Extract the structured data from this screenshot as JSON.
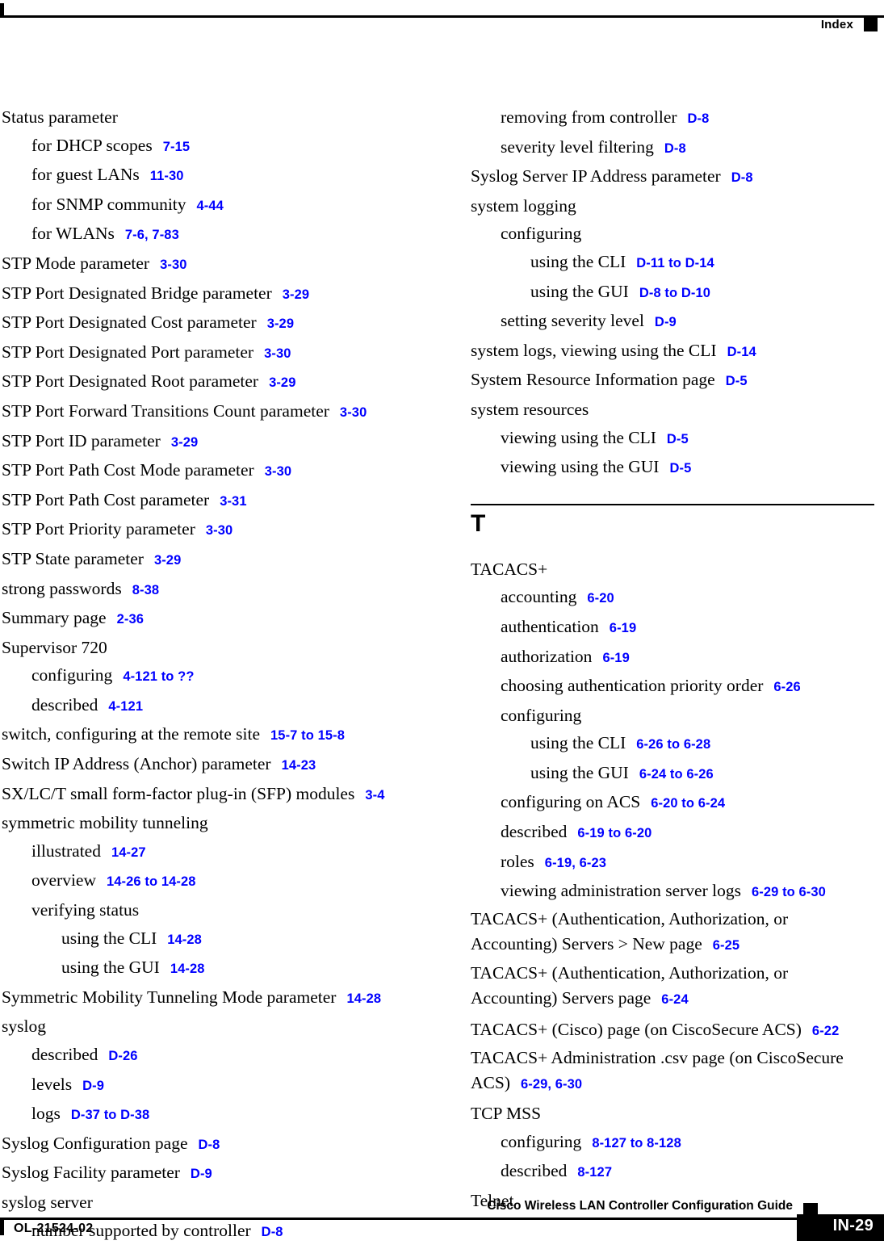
{
  "header": {
    "title": "Index"
  },
  "footer": {
    "guide_title": "Cisco Wireless LAN Controller Configuration Guide",
    "doc_id": "OL-21524-02",
    "page_number": "IN-29"
  },
  "colors": {
    "page_reference": "#0000ff",
    "text": "#000000",
    "background": "#ffffff"
  },
  "left_column": {
    "entries": [
      {
        "level": 0,
        "text": "Status parameter",
        "refs": ""
      },
      {
        "level": 1,
        "text": "for DHCP scopes",
        "refs": "7-15"
      },
      {
        "level": 1,
        "text": "for guest LANs",
        "refs": "11-30"
      },
      {
        "level": 1,
        "text": "for SNMP community",
        "refs": "4-44"
      },
      {
        "level": 1,
        "text": "for WLANs",
        "refs": "7-6, 7-83"
      },
      {
        "level": 0,
        "text": "STP Mode parameter",
        "refs": "3-30"
      },
      {
        "level": 0,
        "text": "STP Port Designated Bridge parameter",
        "refs": "3-29"
      },
      {
        "level": 0,
        "text": "STP Port Designated Cost parameter",
        "refs": "3-29"
      },
      {
        "level": 0,
        "text": "STP Port Designated Port parameter",
        "refs": "3-30"
      },
      {
        "level": 0,
        "text": "STP Port Designated Root parameter",
        "refs": "3-29"
      },
      {
        "level": 0,
        "text": "STP Port Forward Transitions Count parameter",
        "refs": "3-30"
      },
      {
        "level": 0,
        "text": "STP Port ID parameter",
        "refs": "3-29"
      },
      {
        "level": 0,
        "text": "STP Port Path Cost Mode parameter",
        "refs": "3-30"
      },
      {
        "level": 0,
        "text": "STP Port Path Cost parameter",
        "refs": "3-31"
      },
      {
        "level": 0,
        "text": "STP Port Priority parameter",
        "refs": "3-30"
      },
      {
        "level": 0,
        "text": "STP State parameter",
        "refs": "3-29"
      },
      {
        "level": 0,
        "text": "strong passwords",
        "refs": "8-38"
      },
      {
        "level": 0,
        "text": "Summary page",
        "refs": "2-36"
      },
      {
        "level": 0,
        "text": "Supervisor 720",
        "refs": ""
      },
      {
        "level": 1,
        "text": "configuring",
        "refs": "4-121 to ??"
      },
      {
        "level": 1,
        "text": "described",
        "refs": "4-121"
      },
      {
        "level": 0,
        "text": "switch, configuring at the remote site",
        "refs": "15-7 to 15-8"
      },
      {
        "level": 0,
        "text": "Switch IP Address (Anchor) parameter",
        "refs": "14-23"
      },
      {
        "level": 0,
        "text": "SX/LC/T small form-factor plug-in (SFP) modules",
        "refs": "3-4"
      },
      {
        "level": 0,
        "text": "symmetric mobility tunneling",
        "refs": ""
      },
      {
        "level": 1,
        "text": "illustrated",
        "refs": "14-27"
      },
      {
        "level": 1,
        "text": "overview",
        "refs": "14-26 to 14-28"
      },
      {
        "level": 1,
        "text": "verifying status",
        "refs": ""
      },
      {
        "level": 2,
        "text": "using the CLI",
        "refs": "14-28"
      },
      {
        "level": 2,
        "text": "using the GUI",
        "refs": "14-28"
      },
      {
        "level": 0,
        "text": "Symmetric Mobility Tunneling Mode parameter",
        "refs": "14-28"
      },
      {
        "level": 0,
        "text": "syslog",
        "refs": ""
      },
      {
        "level": 1,
        "text": "described",
        "refs": "D-26"
      },
      {
        "level": 1,
        "text": "levels",
        "refs": "D-9"
      },
      {
        "level": 1,
        "text": "logs",
        "refs": "D-37 to D-38"
      },
      {
        "level": 0,
        "text": "Syslog Configuration page",
        "refs": "D-8"
      },
      {
        "level": 0,
        "text": "Syslog Facility parameter",
        "refs": "D-9"
      },
      {
        "level": 0,
        "text": "syslog server",
        "refs": ""
      },
      {
        "level": 1,
        "text": "number supported by controller",
        "refs": "D-8"
      }
    ]
  },
  "right_column": {
    "entries_before_section": [
      {
        "level": 1,
        "text": "removing from controller",
        "refs": "D-8"
      },
      {
        "level": 1,
        "text": "severity level filtering",
        "refs": "D-8"
      },
      {
        "level": 0,
        "text": "Syslog Server IP Address parameter",
        "refs": "D-8"
      },
      {
        "level": 0,
        "text": "system logging",
        "refs": ""
      },
      {
        "level": 1,
        "text": "configuring",
        "refs": ""
      },
      {
        "level": 2,
        "text": "using the CLI",
        "refs": "D-11 to D-14"
      },
      {
        "level": 2,
        "text": "using the GUI",
        "refs": "D-8 to D-10"
      },
      {
        "level": 1,
        "text": "setting severity level",
        "refs": "D-9"
      },
      {
        "level": 0,
        "text": "system logs, viewing using the CLI",
        "refs": "D-14"
      },
      {
        "level": 0,
        "text": "System Resource Information page",
        "refs": "D-5"
      },
      {
        "level": 0,
        "text": "system resources",
        "refs": ""
      },
      {
        "level": 1,
        "text": "viewing using the CLI",
        "refs": "D-5"
      },
      {
        "level": 1,
        "text": "viewing using the GUI",
        "refs": "D-5"
      }
    ],
    "section": {
      "letter": "T"
    },
    "entries_after_section": [
      {
        "level": 0,
        "text": "TACACS+",
        "refs": ""
      },
      {
        "level": 1,
        "text": "accounting",
        "refs": "6-20"
      },
      {
        "level": 1,
        "text": "authentication",
        "refs": "6-19"
      },
      {
        "level": 1,
        "text": "authorization",
        "refs": "6-19"
      },
      {
        "level": 1,
        "text": "choosing authentication priority order",
        "refs": "6-26"
      },
      {
        "level": 1,
        "text": "configuring",
        "refs": ""
      },
      {
        "level": 2,
        "text": "using the CLI",
        "refs": "6-26 to 6-28"
      },
      {
        "level": 2,
        "text": "using the GUI",
        "refs": "6-24 to 6-26"
      },
      {
        "level": 1,
        "text": "configuring on ACS",
        "refs": "6-20 to 6-24"
      },
      {
        "level": 1,
        "text": "described",
        "refs": "6-19 to 6-20"
      },
      {
        "level": 1,
        "text": "roles",
        "refs": "6-19, 6-23"
      },
      {
        "level": 1,
        "text": "viewing administration server logs",
        "refs": "6-29 to 6-30"
      },
      {
        "level": 0,
        "wrap": true,
        "text": "TACACS+ (Authentication, Authorization, or Accounting) Servers > New page",
        "refs": "6-25"
      },
      {
        "level": 0,
        "wrap": true,
        "text": "TACACS+ (Authentication, Authorization, or Accounting) Servers page",
        "refs": "6-24"
      },
      {
        "level": 0,
        "text": "TACACS+ (Cisco) page (on CiscoSecure ACS)",
        "refs": "6-22"
      },
      {
        "level": 0,
        "wrap": true,
        "text": "TACACS+ Administration .csv page (on CiscoSecure ACS)",
        "refs": "6-29, 6-30"
      },
      {
        "level": 0,
        "text": "TCP MSS",
        "refs": ""
      },
      {
        "level": 1,
        "text": "configuring",
        "refs": "8-127 to 8-128"
      },
      {
        "level": 1,
        "text": "described",
        "refs": "8-127"
      },
      {
        "level": 0,
        "text": "Telnet",
        "refs": ""
      }
    ]
  }
}
